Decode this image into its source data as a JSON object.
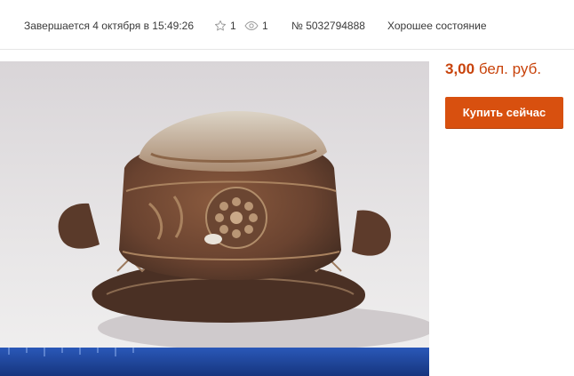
{
  "listing": {
    "ends_text": "Завершается 4 октября в 15:49:26",
    "watchers_count": "1",
    "views_count": "1",
    "lot_number": "№ 5032794888",
    "condition": "Хорошее состояние"
  },
  "offer": {
    "price_amount": "3,00",
    "price_currency": "бел. руб.",
    "buy_now_label": "Купить сейчас"
  },
  "icons": {
    "watchers": "star-outline-icon",
    "views": "eye-icon"
  },
  "colors": {
    "price": "#c8430b",
    "buy_button": "#d8500f",
    "meta_text": "#3a3a3a"
  }
}
